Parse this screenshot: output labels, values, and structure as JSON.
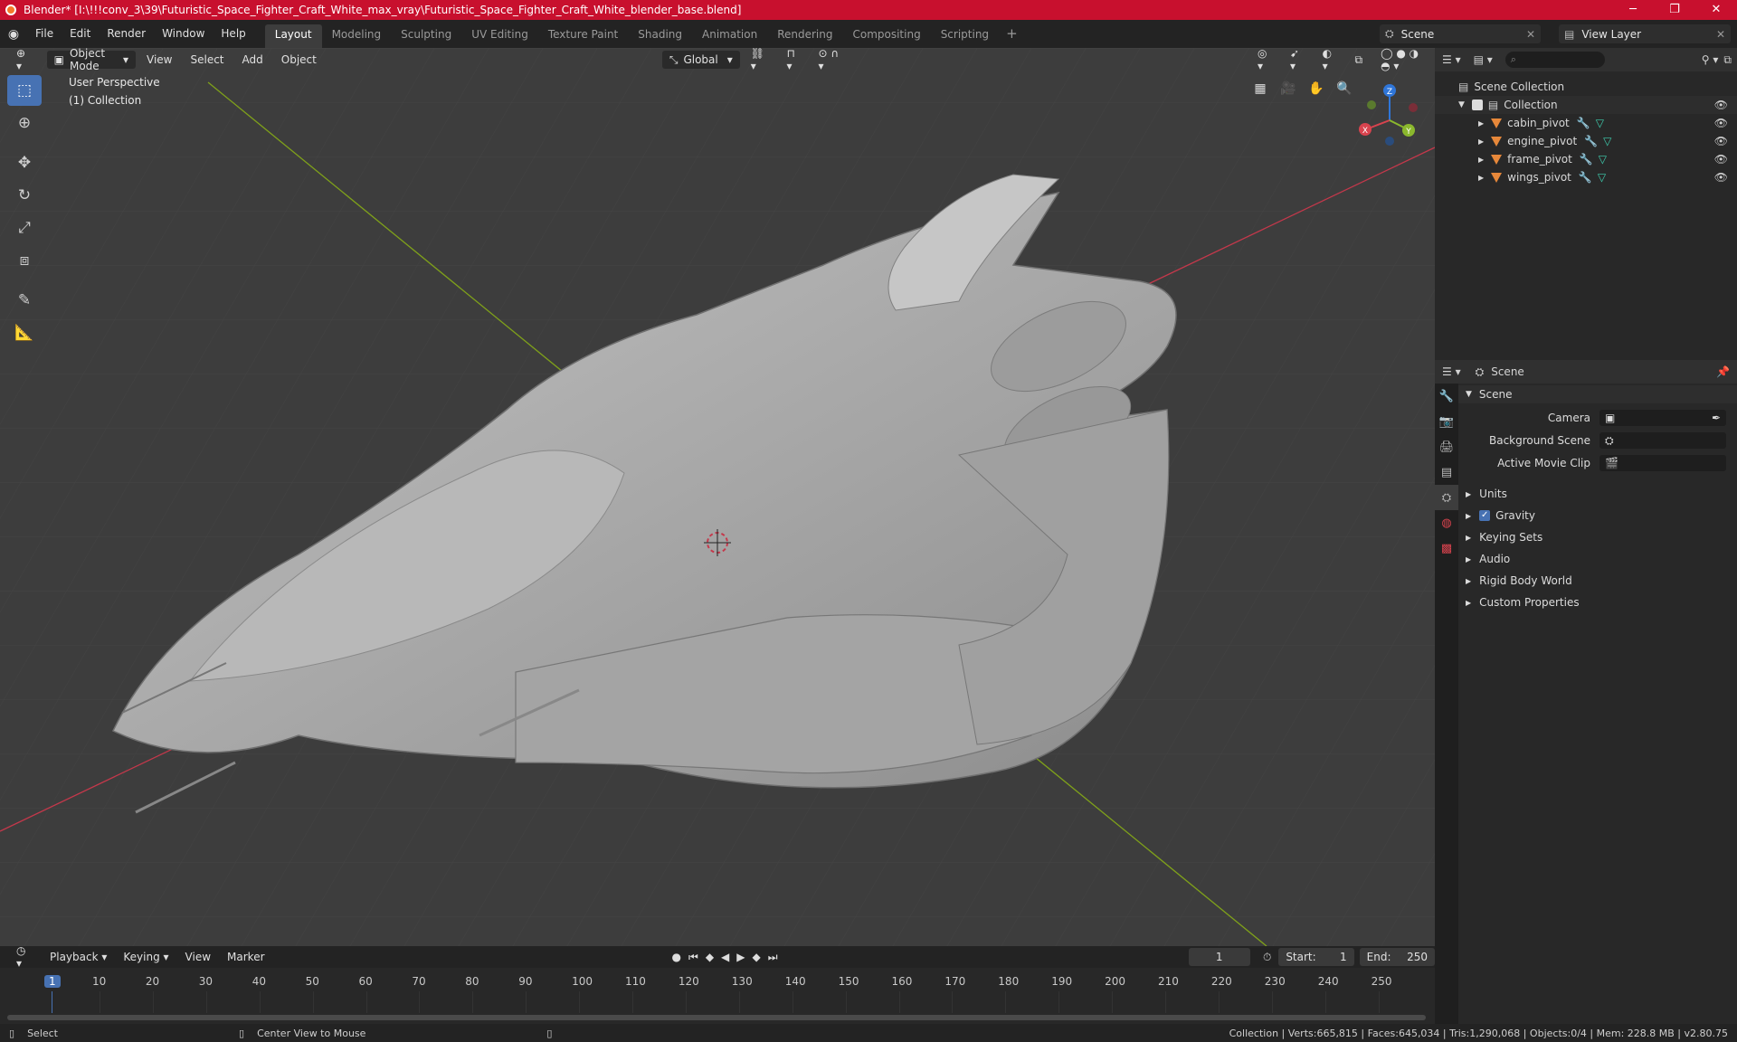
{
  "window": {
    "title": "Blender* [I:\\!!!conv_3\\39\\Futuristic_Space_Fighter_Craft_White_max_vray\\Futuristic_Space_Fighter_Craft_White_blender_base.blend]",
    "minimize": "─",
    "maximize": "❐",
    "close": "✕"
  },
  "menu": {
    "items": [
      "File",
      "Edit",
      "Render",
      "Window",
      "Help"
    ],
    "workspaces": [
      "Layout",
      "Modeling",
      "Sculpting",
      "UV Editing",
      "Texture Paint",
      "Shading",
      "Animation",
      "Rendering",
      "Compositing",
      "Scripting"
    ],
    "active_workspace": "Layout",
    "add_tab": "+",
    "scene": "Scene",
    "view_layer": "View Layer"
  },
  "viewport": {
    "mode": "Object Mode",
    "menus": [
      "View",
      "Select",
      "Add",
      "Object"
    ],
    "transform_orientation": "Global",
    "overlay_line1": "User Perspective",
    "overlay_line2": "(1) Collection",
    "gizmo": {
      "x": "X",
      "y": "Y",
      "z": "Z"
    },
    "colors": {
      "bg": "#3d3d3d",
      "grid": "#444444",
      "x_axis": "#c4384b",
      "y_axis": "#7fa11a",
      "model": "#a9a9a9"
    }
  },
  "outliner": {
    "search_placeholder": "",
    "root": "Scene Collection",
    "collection": "Collection",
    "objects": [
      "cabin_pivot",
      "engine_pivot",
      "frame_pivot",
      "wings_pivot"
    ]
  },
  "properties": {
    "header": "Scene",
    "section": "Scene",
    "fields": [
      {
        "label": "Camera",
        "value": ""
      },
      {
        "label": "Background Scene",
        "value": ""
      },
      {
        "label": "Active Movie Clip",
        "value": ""
      }
    ],
    "panels": [
      "Units",
      "Gravity",
      "Keying Sets",
      "Audio",
      "Rigid Body World",
      "Custom Properties"
    ],
    "gravity_checked": true
  },
  "timeline": {
    "menus": [
      "Playback",
      "Keying",
      "View",
      "Marker"
    ],
    "current_frame": "1",
    "start_label": "Start:",
    "start": "1",
    "end_label": "End:",
    "end": "250",
    "ruler": [
      "1",
      "10",
      "20",
      "30",
      "40",
      "50",
      "60",
      "70",
      "80",
      "90",
      "100",
      "110",
      "120",
      "130",
      "140",
      "150",
      "160",
      "170",
      "180",
      "190",
      "200",
      "210",
      "220",
      "230",
      "240",
      "250"
    ]
  },
  "status": {
    "select": "Select",
    "center": "Center View to Mouse",
    "stats": "Collection | Verts:665,815 | Faces:645,034 | Tris:1,290,068 | Objects:0/4 | Mem: 228.8 MB | v2.80.75"
  }
}
